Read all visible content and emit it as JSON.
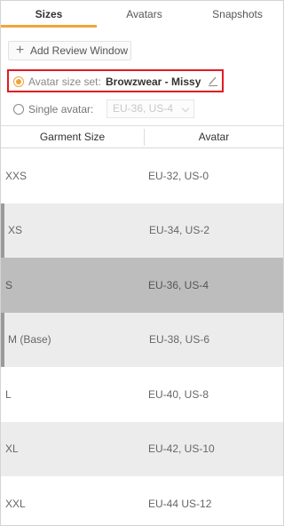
{
  "tabs": [
    {
      "label": "Sizes",
      "active": true
    },
    {
      "label": "Avatars",
      "active": false
    },
    {
      "label": "Snapshots",
      "active": false
    }
  ],
  "add_review_label": "Add Review Window",
  "avatar_size_set": {
    "label": "Avatar size set:",
    "value": "Browzwear - Missy",
    "selected": true
  },
  "single_avatar": {
    "label": "Single avatar:",
    "value": "EU-36, US-4",
    "selected": false,
    "disabled": true
  },
  "table": {
    "columns": [
      "Garment Size",
      "Avatar"
    ],
    "rows": [
      {
        "size": "XXS",
        "avatar": "EU-32, US-0"
      },
      {
        "size": "XS",
        "avatar": "EU-34, US-2"
      },
      {
        "size": "S",
        "avatar": "EU-36, US-4"
      },
      {
        "size": "M (Base)",
        "avatar": "EU-38, US-6"
      },
      {
        "size": "L",
        "avatar": "EU-40, US-8"
      },
      {
        "size": "XL",
        "avatar": "EU-42, US-10"
      },
      {
        "size": "XXL",
        "avatar": "EU-44 US-12"
      }
    ]
  },
  "colors": {
    "accent": "#f2a33a",
    "highlight_border": "#e21b22",
    "row_selected": "#bdbdbd",
    "row_alt": "#ececec"
  }
}
